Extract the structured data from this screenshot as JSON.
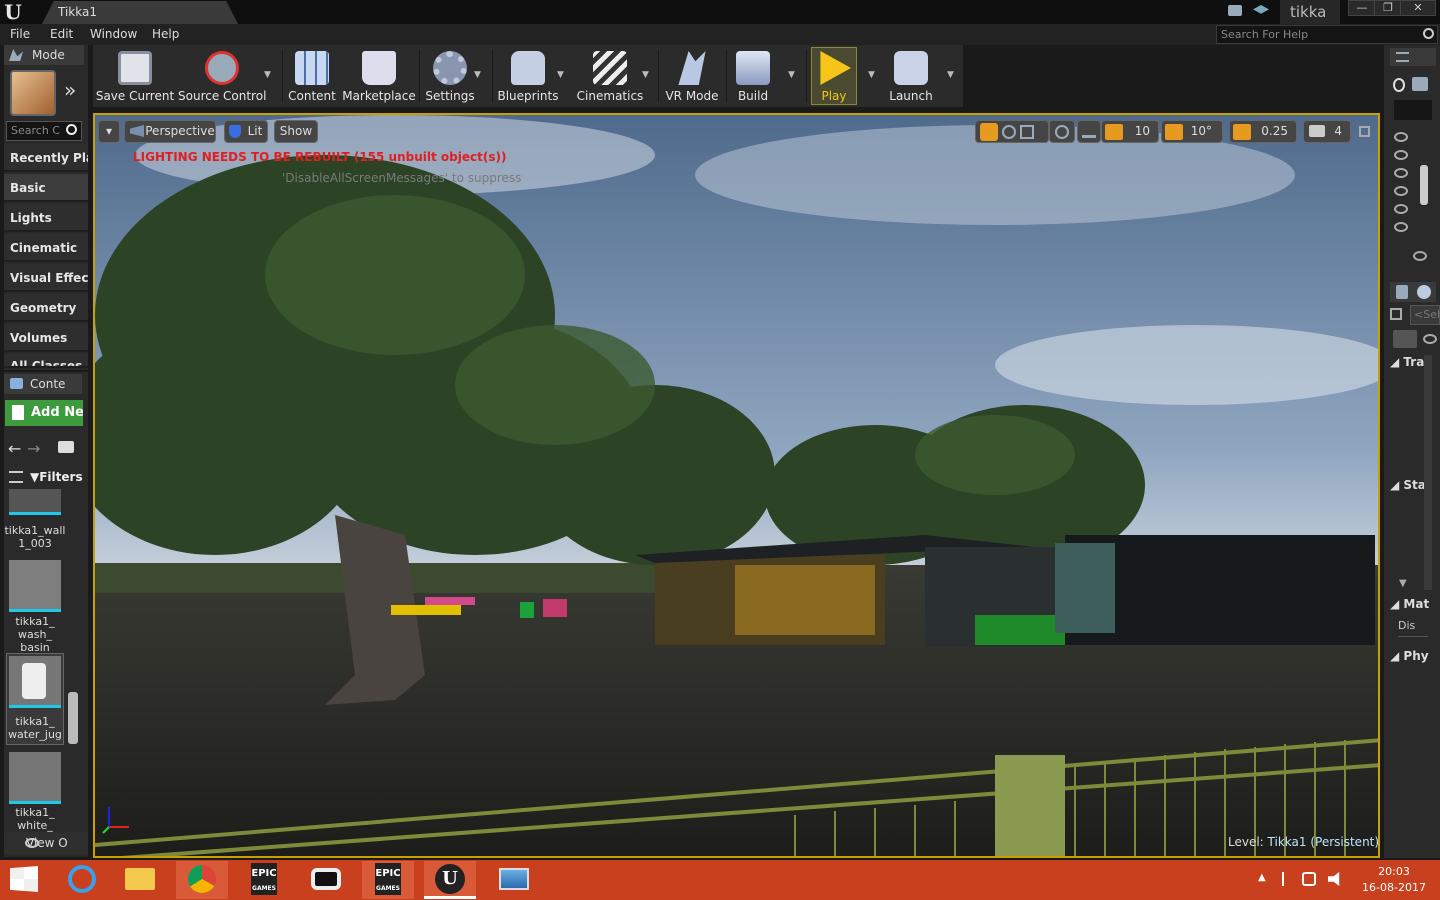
{
  "window": {
    "tab_title": "Tikka1",
    "project_name": "tikka",
    "minimize": "—",
    "maximize": "❐",
    "close": "✕"
  },
  "menu": {
    "items": [
      "File",
      "Edit",
      "Window",
      "Help"
    ],
    "search_placeholder": "Search For Help"
  },
  "modes": {
    "tab_label": "Mode",
    "search_placeholder": "Search C",
    "categories": [
      {
        "label": "Recently Plac",
        "selected": false
      },
      {
        "label": "Basic",
        "selected": true
      },
      {
        "label": "Lights",
        "selected": false
      },
      {
        "label": "Cinematic",
        "selected": false
      },
      {
        "label": "Visual Effect",
        "selected": false
      },
      {
        "label": "Geometry",
        "selected": false
      },
      {
        "label": "Volumes",
        "selected": false
      },
      {
        "label": "All Classes",
        "selected": false
      }
    ]
  },
  "content_browser": {
    "tab_label": "Conte",
    "add_new": "Add Ne",
    "filters": "Filters",
    "view_options": "View O",
    "assets": [
      {
        "name_line1": "tikka1_wall",
        "name_line2": "1_003"
      },
      {
        "name_line1": "tikka1_",
        "name_line2": "wash_",
        "name_line3": "basin"
      },
      {
        "name_line1": "tikka1_",
        "name_line2": "water_jug"
      },
      {
        "name_line1": "tikka1_",
        "name_line2": "white_"
      }
    ]
  },
  "toolbar": {
    "save_current": "Save Current",
    "source_control": "Source Control",
    "content": "Content",
    "marketplace": "Marketplace",
    "settings": "Settings",
    "blueprints": "Blueprints",
    "cinematics": "Cinematics",
    "vr_mode": "VR Mode",
    "build": "Build",
    "play": "Play",
    "launch": "Launch",
    "play_color": "#f5c518"
  },
  "viewport": {
    "perspective": "Perspective",
    "lit": "Lit",
    "show": "Show",
    "grid_snap": "10",
    "rotation_snap": "10°",
    "scale_snap": "0.25",
    "camera_speed": "4",
    "lighting_warning": "LIGHTING NEEDS TO BE REBUILT (155 unbuilt object(s))",
    "suppress_hint": "'DisableAllScreenMessages' to suppress",
    "level_prefix": "Level:",
    "level_name": "Tikka1 (Persistent)",
    "warning_color": "#e02020",
    "highlight_color": "#c8a000"
  },
  "details": {
    "select_placeholder": "<Sel",
    "sections": [
      "Tra",
      "Sta",
      "Mat",
      "Phy"
    ],
    "dis_label": "Dis"
  },
  "taskbar": {
    "time": "20:03",
    "date": "16-08-2017",
    "epic_label": "EPIC",
    "games_label": "GAMES"
  }
}
